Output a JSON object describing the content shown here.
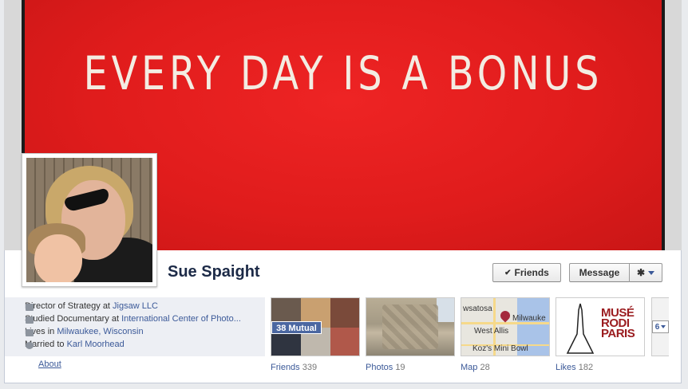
{
  "cover": {
    "text": "EVERY DAY IS A BONUS"
  },
  "profile": {
    "name": "Sue Spaight",
    "avatar_icon": "profile-photo"
  },
  "actions": {
    "friends_label": "Friends",
    "friends_icon": "check-icon",
    "message_label": "Message",
    "gear_icon": "gear-icon"
  },
  "about": {
    "items": [
      {
        "icon": "briefcase-icon",
        "prefix": "Director of Strategy at ",
        "link": "Jigsaw LLC"
      },
      {
        "icon": "graduation-cap-icon",
        "prefix": "Studied Documentary at ",
        "link": "International Center of Photo..."
      },
      {
        "icon": "house-icon",
        "prefix": "Lives in ",
        "link": "Milwaukee, Wisconsin"
      },
      {
        "icon": "heart-icon",
        "prefix": "Married to ",
        "link": "Karl Moorhead"
      }
    ],
    "about_link": "About"
  },
  "tiles": {
    "friends": {
      "label": "Friends",
      "count": "339",
      "badge": "38 Mutual"
    },
    "photos": {
      "label": "Photos",
      "count": "19"
    },
    "map": {
      "label": "Map",
      "count": "28",
      "places": [
        "wsatosa",
        "Milwauke",
        "West Allis",
        "Koz's Mini Bowl"
      ]
    },
    "likes": {
      "label": "Likes",
      "count": "182",
      "logo_text": "MUSÉ RODI PARIS"
    }
  },
  "more": {
    "label": "6"
  },
  "colors": {
    "cover_red": "#e01c1c",
    "link_blue": "#3b5998",
    "name_navy": "#1c2a47",
    "badge_blue": "#4b67a1"
  }
}
